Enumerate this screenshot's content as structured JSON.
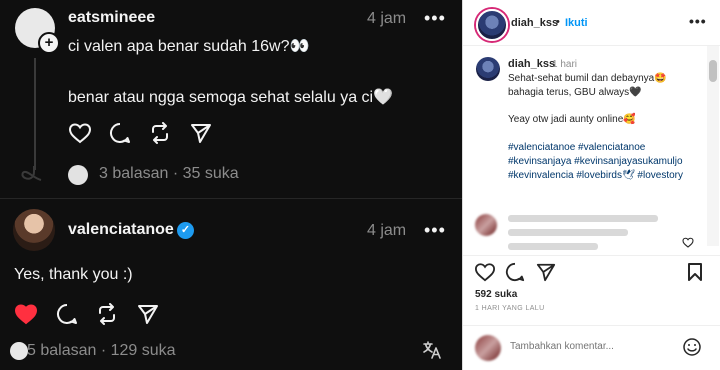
{
  "threads": {
    "post1": {
      "username": "eatsmineee",
      "time": "4 jam",
      "more": "•••",
      "line1": "ci valen apa benar sudah 16w?👀",
      "line2": "benar atau ngga semoga sehat selalu ya ci🤍",
      "replies_meta": "3 balasan · 35 suka"
    },
    "post2": {
      "username": "valenciatanoe",
      "time": "4 jam",
      "more": "•••",
      "text": "Yes, thank you :)",
      "replies_meta": "5 balasan · 129 suka",
      "liked": true
    },
    "icons": {
      "like": "heart-icon",
      "comment": "comment-icon",
      "repost": "repost-icon",
      "share": "send-icon",
      "translate": "translate-icon"
    },
    "colors": {
      "background": "#0f0f0f",
      "like_active": "#ff3040",
      "verified": "#1d9bf0"
    }
  },
  "instagram": {
    "header": {
      "username": "diah_kss",
      "separator": "•",
      "follow": "Ikuti",
      "more": "•••"
    },
    "caption": {
      "username": "diah_kss",
      "time": "1 hari",
      "line1": "Sehat-sehat bumil dan debaynya🤩",
      "line2": "bahagia terus, GBU always🖤",
      "line3": "Yeay otw jadi aunty online🥰",
      "tags": [
        "#valenciatanoe #valenciatanoe",
        "#kevinsanjaya #kevinsanjayasukamuljo",
        "#kevinvalencia #lovebirds🕊 #lovestory"
      ]
    },
    "likes": "592 suka",
    "posted_ago": "1 HARI YANG LALU",
    "comment_placeholder": "Tambahkan komentar...",
    "post_label": "Kirim",
    "colors": {
      "link": "#0095f6",
      "tag": "#00376b"
    }
  }
}
